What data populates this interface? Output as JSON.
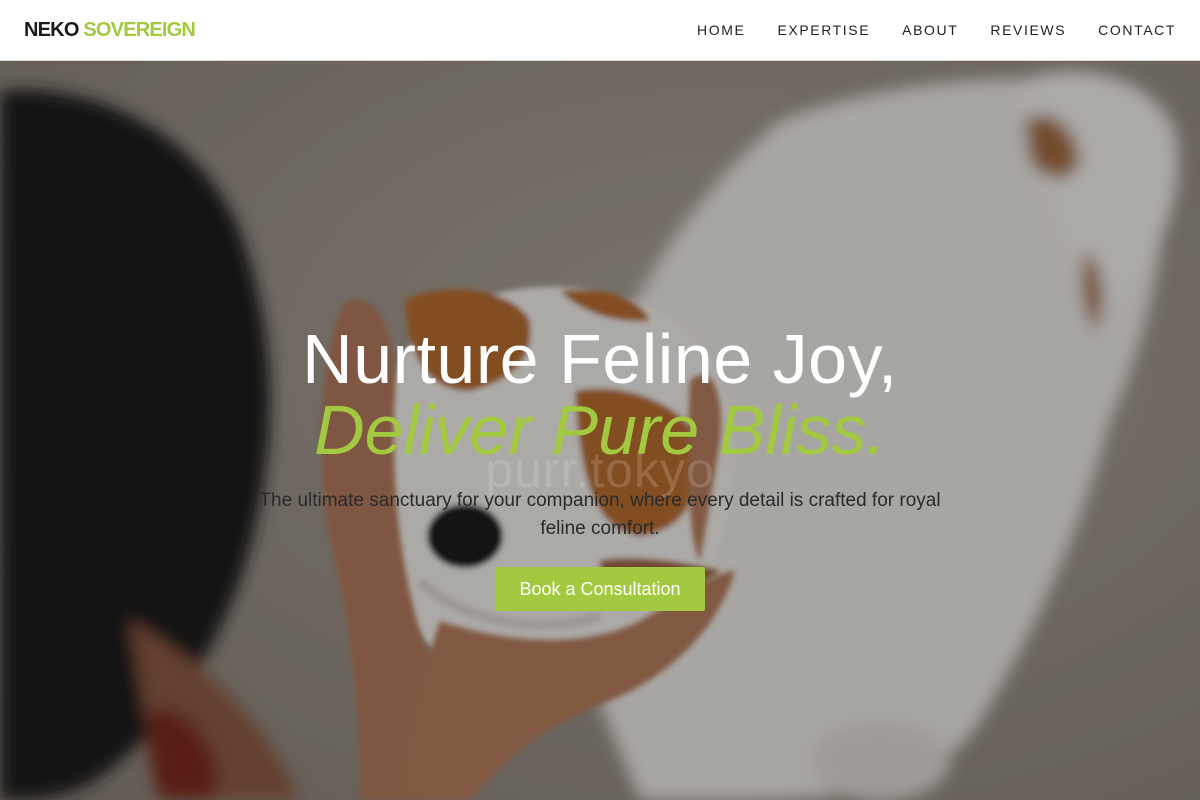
{
  "brand": {
    "name_primary": "NEKO",
    "name_accent": "SOVEREIGN"
  },
  "nav": {
    "items": [
      {
        "label": "HOME"
      },
      {
        "label": "EXPERTISE"
      },
      {
        "label": "ABOUT"
      },
      {
        "label": "REVIEWS"
      },
      {
        "label": "CONTACT"
      }
    ]
  },
  "hero": {
    "headline_line1": "Nurture Feline Joy,",
    "headline_line2": "Deliver Pure Bliss.",
    "subtext": "The ultimate sanctuary for your companion, where every detail is crafted for royal feline comfort.",
    "cta_label": "Book a Consultation",
    "watermark": "purr.tokyo",
    "photo_alt": "Person cradling a white and brown dog's face in their hands"
  },
  "colors": {
    "accent": "#a3c940",
    "header_bg": "#ffffff",
    "nav_text": "#222222",
    "headline_white": "#ffffff",
    "subtext": "#2a2a2a"
  }
}
